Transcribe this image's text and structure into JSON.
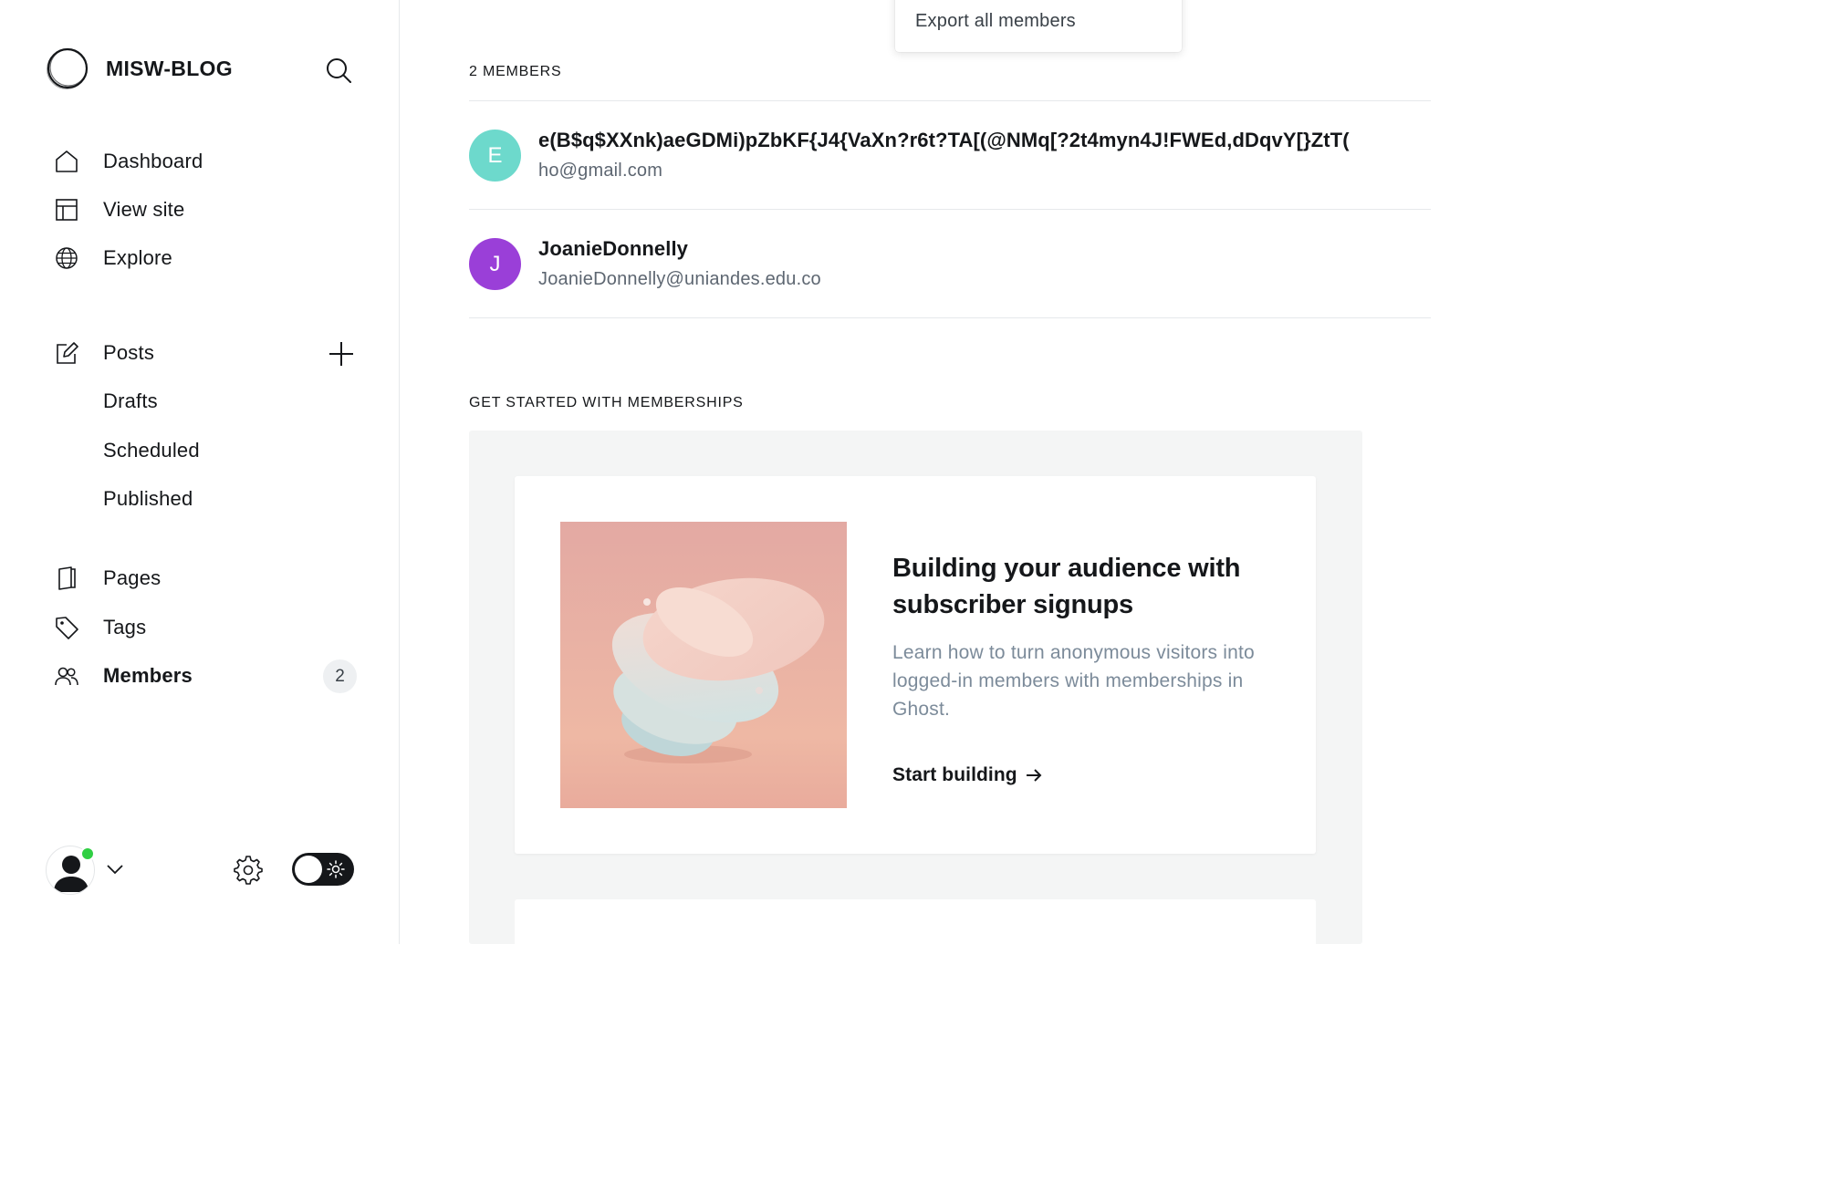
{
  "sidebar": {
    "site_title": "MISW-BLOG",
    "nav_main": [
      {
        "label": "Dashboard",
        "icon": "home-icon"
      },
      {
        "label": "View site",
        "icon": "layout-icon"
      },
      {
        "label": "Explore",
        "icon": "globe-icon"
      }
    ],
    "posts": {
      "label": "Posts",
      "icon": "edit-icon",
      "sub_items": [
        "Drafts",
        "Scheduled",
        "Published"
      ]
    },
    "nav_secondary": [
      {
        "label": "Pages",
        "icon": "page-icon"
      },
      {
        "label": "Tags",
        "icon": "tag-icon"
      },
      {
        "label": "Members",
        "icon": "members-icon",
        "active": true,
        "count": "2"
      }
    ],
    "user_status": "online",
    "theme_mode": "light"
  },
  "dropdown": {
    "export_label": "Export all members"
  },
  "members": {
    "count_label": "2 MEMBERS",
    "rows": [
      {
        "initial": "E",
        "name": "e(B$q$XXnk)aeGDMi)pZbKF{J4{VaXn?r6t?TA[(@NMq[?2t4myn4J!FWEd,dDqvY[}ZtT(",
        "email": "ho@gmail.com",
        "color": "#6dd9cc"
      },
      {
        "initial": "J",
        "name": "JoanieDonnelly",
        "email": "JoanieDonnelly@uniandes.edu.co",
        "color": "#9a3fd8"
      }
    ]
  },
  "get_started": {
    "title": "GET STARTED WITH MEMBERSHIPS",
    "card": {
      "title": "Building your audience with subscriber signups",
      "description": "Learn how to turn anonymous visitors into logged-in members with memberships in Ghost.",
      "cta": "Start building"
    }
  }
}
